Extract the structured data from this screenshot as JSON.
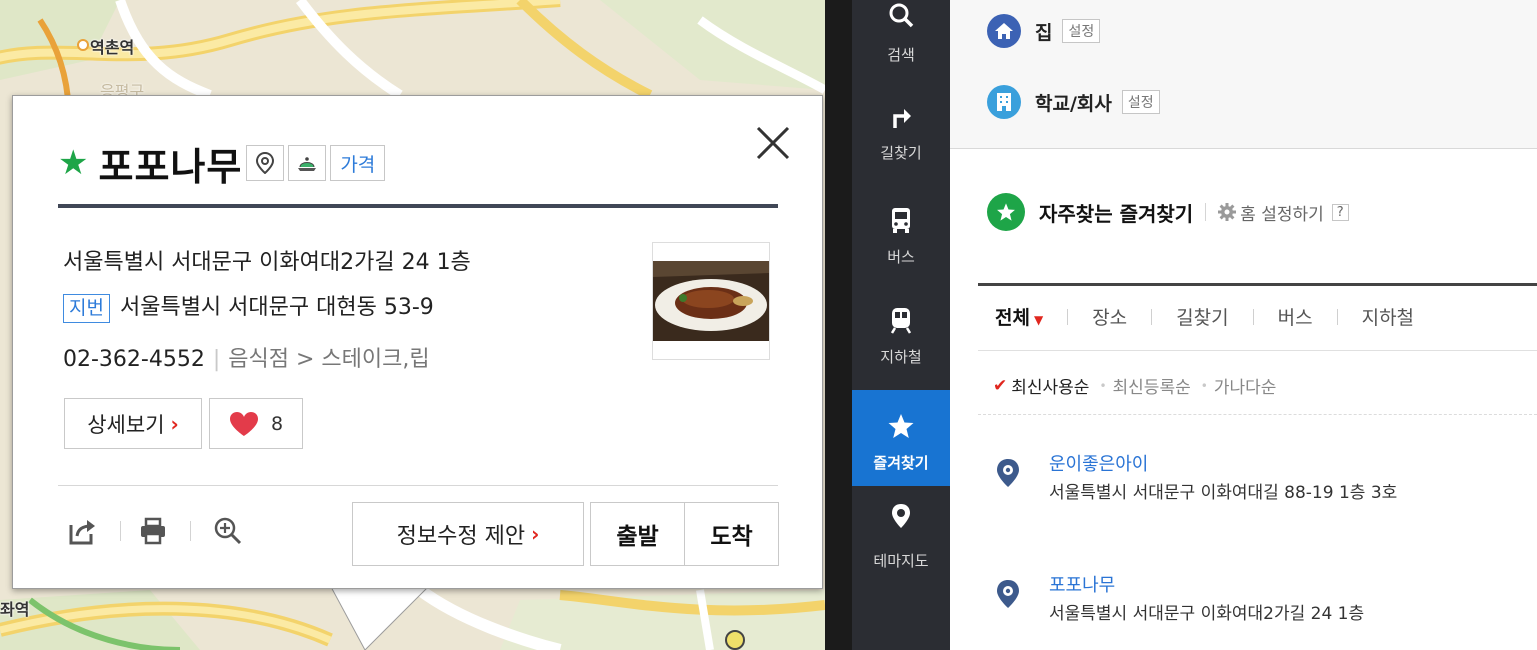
{
  "map": {
    "station_top": "역촌역",
    "station_partial_bottom": "좌역",
    "faded_label": "응평구"
  },
  "popup": {
    "title": "포포나무",
    "price_badge": "가격",
    "road_address": "서울특별시 서대문구 이화여대2가길 24 1층",
    "jibun_badge": "지번",
    "jibun_address": "서울특별시 서대문구 대현동 53-9",
    "phone": "02-362-4552",
    "category": "음식점 > 스테이크,립",
    "detail_button": "상세보기",
    "like_count": "8",
    "suggest_edit_button": "정보수정 제안",
    "depart_button": "출발",
    "arrive_button": "도착"
  },
  "nav": {
    "items": [
      {
        "label": "검색",
        "icon": "search-icon"
      },
      {
        "label": "길찾기",
        "icon": "directions-icon"
      },
      {
        "label": "버스",
        "icon": "bus-icon"
      },
      {
        "label": "지하철",
        "icon": "subway-icon"
      },
      {
        "label": "즐겨찾기",
        "icon": "star-icon"
      },
      {
        "label": "테마지도",
        "icon": "theme-map-icon"
      }
    ]
  },
  "panel": {
    "home_label": "집",
    "home_set": "설정",
    "work_label": "학교/회사",
    "work_set": "설정",
    "favorites_title": "자주찾는 즐겨찾기",
    "home_setting_link": "홈 설정하기",
    "help_badge": "?",
    "tabs": [
      "전체",
      "장소",
      "길찾기",
      "버스",
      "지하철"
    ],
    "sort_options": [
      "최신사용순",
      "최신등록순",
      "가나다순"
    ],
    "favorites": [
      {
        "name": "운이좋은아이",
        "address": "서울특별시 서대문구 이화여대길 88-19 1층 3호"
      },
      {
        "name": "포포나무",
        "address": "서울특별시 서대문구 이화여대2가길 24 1층"
      }
    ]
  },
  "colors": {
    "accent_blue": "#1874d2",
    "favorite_green": "#1ea548",
    "red": "#e0271f",
    "nav_bg": "#2b2d33"
  }
}
